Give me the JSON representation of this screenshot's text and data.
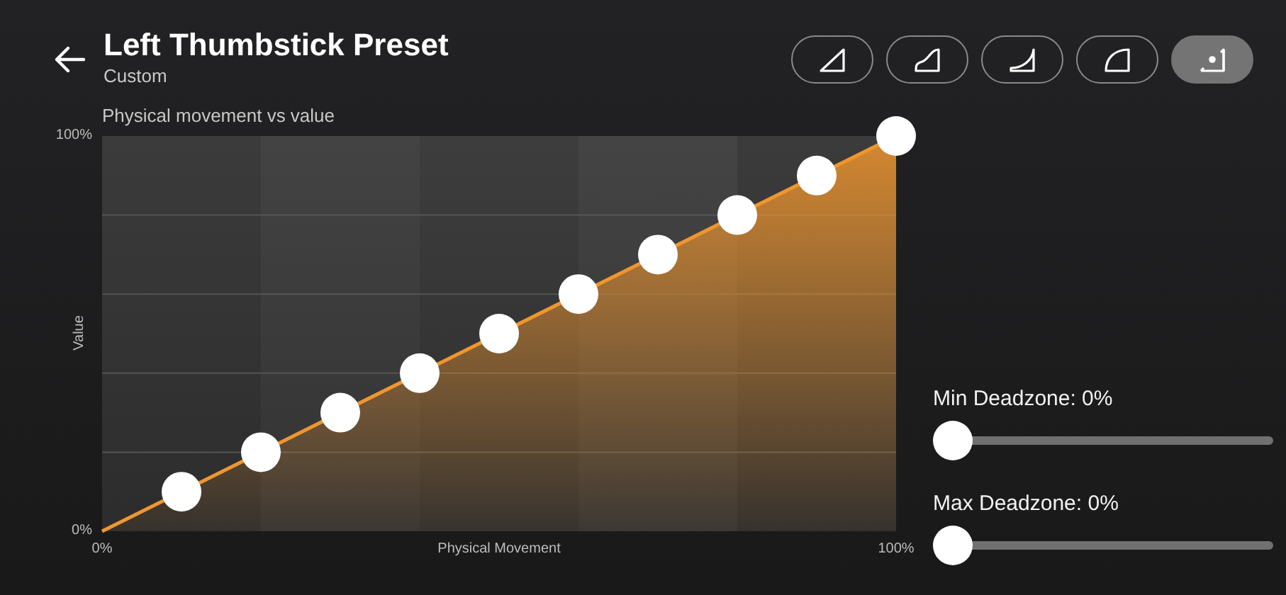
{
  "header": {
    "title": "Left Thumbstick Preset",
    "subtitle": "Custom"
  },
  "presets": [
    {
      "kind": "linear",
      "selected": false
    },
    {
      "kind": "smooth",
      "selected": false
    },
    {
      "kind": "exponential",
      "selected": false
    },
    {
      "kind": "aggressive",
      "selected": false
    },
    {
      "kind": "custom",
      "selected": true
    }
  ],
  "curve": {
    "chart_data": {
      "type": "area",
      "title": "Physical movement vs value",
      "xlabel": "Physical Movement",
      "ylabel": "Value",
      "x": [
        0,
        10,
        20,
        30,
        40,
        50,
        60,
        70,
        80,
        90,
        100
      ],
      "series": [
        {
          "color": "#f0962e",
          "values": [
            0,
            10,
            20,
            30,
            40,
            50,
            60,
            70,
            80,
            90,
            100
          ]
        }
      ],
      "xlim": [
        0,
        100
      ],
      "ylim": [
        0,
        100
      ],
      "xticks": [
        {
          "value": 0,
          "label": "0%"
        },
        {
          "value": 100,
          "label": "100%"
        }
      ],
      "yticks": [
        {
          "value": 0,
          "label": "0%"
        },
        {
          "value": 100,
          "label": "100%"
        }
      ]
    }
  },
  "sliders": [
    {
      "label": "Min Deadzone: 0%",
      "level": 0
    },
    {
      "label": "Max Deadzone: 0%",
      "level": 0
    }
  ]
}
